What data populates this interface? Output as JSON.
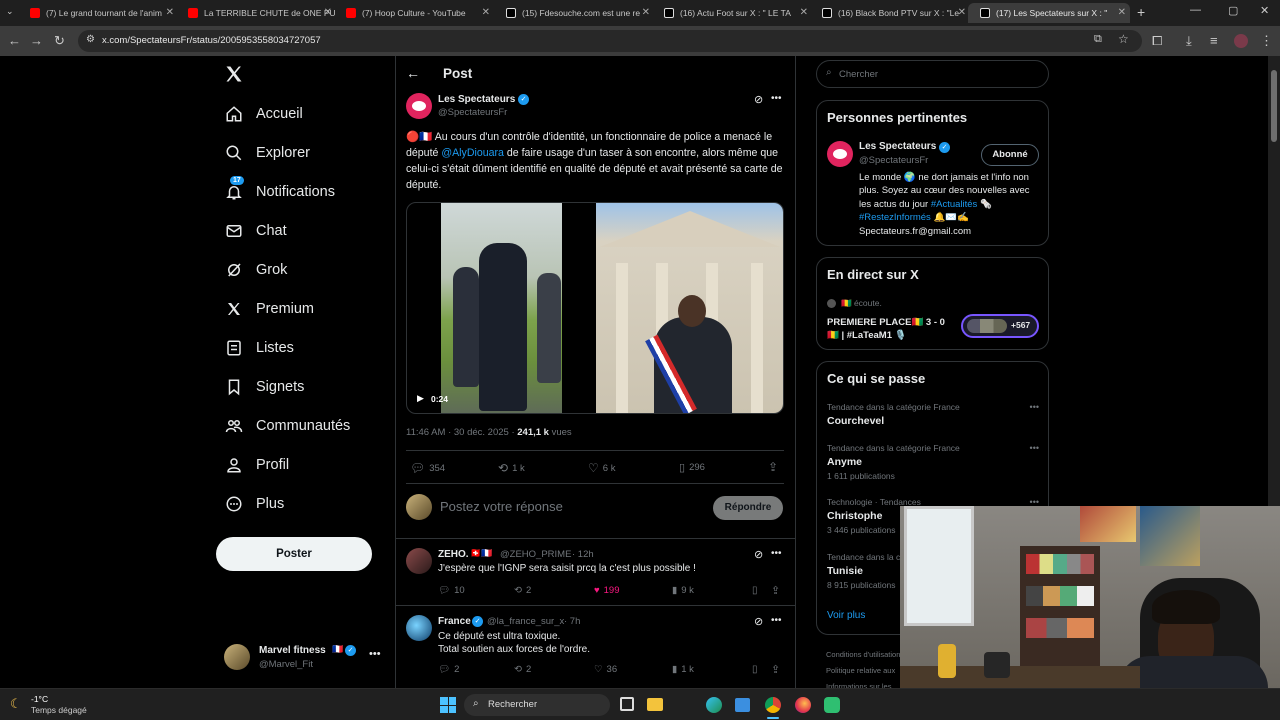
{
  "browser": {
    "tabs": [
      {
        "label": "(7) Le grand tournant de l'anim",
        "icon": "youtube-icon"
      },
      {
        "label": "La TERRIBLE CHUTE de ONE PU",
        "icon": "youtube-icon"
      },
      {
        "label": "(7) Hoop Culture - YouTube",
        "icon": "youtube-icon"
      },
      {
        "label": "(15) Fdesouche.com est une re",
        "icon": "x-logo-icon"
      },
      {
        "label": "(16) Actu Foot sur X : \" LE TA",
        "icon": "x-logo-icon"
      },
      {
        "label": "(16) Black Bond PTV sur X : \"Le",
        "icon": "x-logo-icon"
      },
      {
        "label": "(17) Les Spectateurs sur X : \"",
        "icon": "x-logo-icon"
      }
    ],
    "url": "x.com/SpectateursFr/status/2005953558034727057"
  },
  "nav": {
    "items": [
      {
        "label": "Accueil",
        "icon": "home-icon"
      },
      {
        "label": "Explorer",
        "icon": "search-icon"
      },
      {
        "label": "Notifications",
        "icon": "bell-icon"
      },
      {
        "label": "Chat",
        "icon": "mail-icon"
      },
      {
        "label": "Grok",
        "icon": "grok-icon"
      },
      {
        "label": "Premium",
        "icon": "x-logo-icon"
      },
      {
        "label": "Listes",
        "icon": "list-icon"
      },
      {
        "label": "Signets",
        "icon": "bookmark-icon"
      },
      {
        "label": "Communautés",
        "icon": "communities-icon"
      },
      {
        "label": "Profil",
        "icon": "person-icon"
      },
      {
        "label": "Plus",
        "icon": "more-circle-icon"
      }
    ],
    "notif_badge": "17",
    "post_button": "Poster",
    "account": {
      "name": "Marvel fitness",
      "flag": "🇫🇷",
      "handle": "@Marvel_Fit"
    }
  },
  "post": {
    "header": "Post",
    "author_name": "Les Spectateurs",
    "author_handle": "@SpectateursFr",
    "text_before": "🔴🇫🇷 Au cours d'un contrôle d'identité, un fonctionnaire de police a menacé le député ",
    "mention": "@AlyDiouara",
    "text_after": " de faire usage d'un taser à son encontre, alors même que celui-ci s'était dûment identifié en qualité de député et avait présenté sa carte de député.",
    "video_duration": "0:24",
    "timestamp": "11:46 AM · 30 déc. 2025 · ",
    "views_count": "241,1 k",
    "views_label": " vues",
    "stats": {
      "replies": "354",
      "reposts": "1 k",
      "likes": "6 k",
      "bookmarks": "296"
    },
    "reply_placeholder": "Postez votre réponse",
    "reply_button": "Répondre"
  },
  "replies": [
    {
      "name": "ZEHO.",
      "flags": "🇨🇭🇫🇷",
      "handle": "@ZEHO_PRIME",
      "time": "· 12h",
      "text": "J'espère que l'IGNP sera saisit prcq la c'est plus possible !",
      "replies": "10",
      "reposts": "2",
      "likes": "199",
      "views": "9 k"
    },
    {
      "name": "France",
      "handle": "@la_france_sur_x",
      "time": "· 7h",
      "text": "Ce député est ultra toxique.\nTotal soutien aux forces de l'ordre.",
      "replies": "2",
      "reposts": "2",
      "likes": "36",
      "views": "1 k"
    }
  ],
  "sidebar": {
    "search_placeholder": "Chercher",
    "relevant": {
      "title": "Personnes pertinentes",
      "name": "Les Spectateurs",
      "handle": "@SpectateursFr",
      "button": "Abonné",
      "bio_1": "Le monde 🌍 ne dort jamais et l'info non plus. Soyez au cœur des nouvelles avec les actus du jour ",
      "bio_tag1": "#Actualités",
      "bio_2": " 🗞️ ",
      "bio_tag2": "#RestezInformés",
      "bio_3": " 🔔✉️✍️ Spectateurs.fr@gmail.com"
    },
    "live": {
      "title": "En direct sur X",
      "listen": "🇬🇳 écoute.",
      "space_title": "PREMIERE PLACE🇬🇳 3 - 0 🇬🇳 | #LaTeaM1 🎙️",
      "count": "+567"
    },
    "trends": {
      "title": "Ce qui se passe",
      "items": [
        {
          "meta": "Tendance dans la catégorie France",
          "name": "Courchevel",
          "count": ""
        },
        {
          "meta": "Tendance dans la catégorie France",
          "name": "Anyme",
          "count": "1 611 publications"
        },
        {
          "meta": "Technologie · Tendances",
          "name": "Christophe",
          "count": "3 446 publications"
        },
        {
          "meta": "Tendance dans la catégorie France",
          "name": "Tunisie",
          "count": "8 915 publications"
        }
      ],
      "more": "Voir plus"
    },
    "footer": [
      "Conditions d'utilisation",
      "Politique relative aux",
      "Informations sur les"
    ]
  },
  "taskbar": {
    "temp": "-1°C",
    "weather": "Temps dégagé",
    "search": "Rechercher"
  },
  "colors": {
    "accent": "#1d9bf0",
    "like": "#f91880",
    "verified": "#1d9bf0"
  }
}
